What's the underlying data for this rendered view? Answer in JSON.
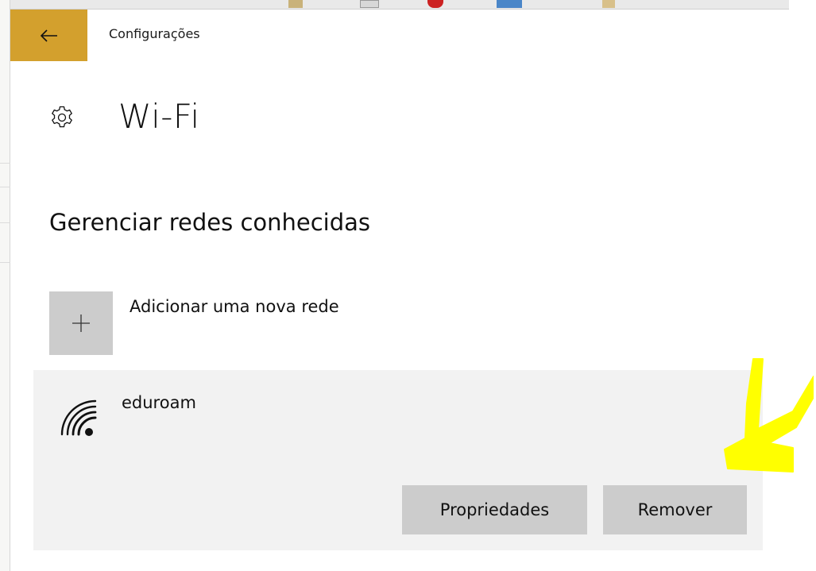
{
  "window": {
    "app_title": "Configurações",
    "back_icon": "arrow-left-icon",
    "accent_color": "#d3a02d"
  },
  "page": {
    "title": "Wi-Fi",
    "icon": "gear-icon"
  },
  "section": {
    "title": "Gerenciar redes conhecidas"
  },
  "add_network": {
    "label": "Adicionar uma nova rede",
    "icon": "plus-icon"
  },
  "known_networks": [
    {
      "name": "eduroam",
      "icon": "wifi-signal-icon",
      "properties_label": "Propriedades",
      "remove_label": "Remover"
    }
  ],
  "annotation": {
    "icon": "yellow-arrow-annotation",
    "color": "#ffff00"
  }
}
